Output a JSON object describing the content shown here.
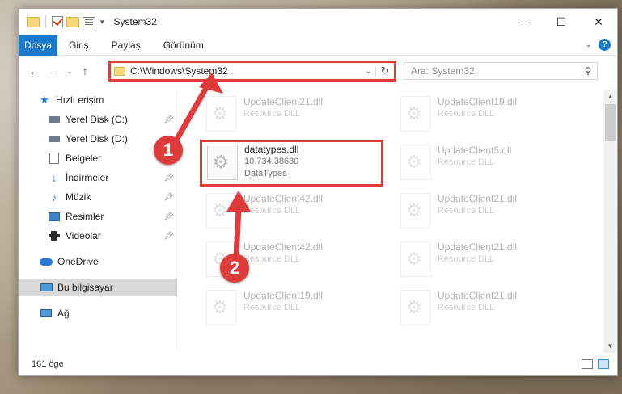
{
  "window": {
    "title": "System32",
    "controls": {
      "minimize": "—",
      "maximize": "☐",
      "close": "✕"
    }
  },
  "ribbon": {
    "tabs": [
      "Dosya",
      "Giriş",
      "Paylaş",
      "Görünüm"
    ]
  },
  "nav": {
    "back": "←",
    "forward": "→",
    "recent": "⌄",
    "up": "↑",
    "address": "C:\\Windows\\System32",
    "refresh": "↻",
    "search_placeholder": "Ara: System32"
  },
  "sidebar": {
    "items": [
      {
        "label": "Hızlı erişim",
        "icon": "star-icon"
      },
      {
        "label": "Yerel Disk (C:)",
        "icon": "drive-icon",
        "pinned": true
      },
      {
        "label": "Yerel Disk (D:)",
        "icon": "drive-icon",
        "pinned": false
      },
      {
        "label": "Belgeler",
        "icon": "documents-icon",
        "pinned": true
      },
      {
        "label": "İndirmeler",
        "icon": "download-icon",
        "pinned": true
      },
      {
        "label": "Müzik",
        "icon": "music-icon",
        "pinned": true
      },
      {
        "label": "Resimler",
        "icon": "pictures-icon",
        "pinned": true
      },
      {
        "label": "Videolar",
        "icon": "videos-icon",
        "pinned": true
      },
      {
        "label": "OneDrive",
        "icon": "cloud-icon"
      },
      {
        "label": "Bu bilgisayar",
        "icon": "computer-icon",
        "selected": true
      },
      {
        "label": "Ağ",
        "icon": "network-icon"
      }
    ]
  },
  "files": {
    "left": [
      {
        "name": "UpdateClient21.dll",
        "type": "Resource DLL"
      },
      {
        "name": "UpdateClient42.dll",
        "type": "Resource DLL"
      },
      {
        "name": "UpdateClient42.dll",
        "type": "Resource DLL"
      },
      {
        "name": "UpdateClient19.dll",
        "type": "Resource DLL"
      }
    ],
    "right": [
      {
        "name": "UpdateClient19.dll",
        "type": "Resource DLL"
      },
      {
        "name": "UpdateClient5.dll",
        "type": "Resource DLL"
      },
      {
        "name": "UpdateClient21.dll",
        "type": "Resource DLL"
      },
      {
        "name": "UpdateClient21.dll",
        "type": "Resource DLL"
      },
      {
        "name": "UpdateClient21.dll",
        "type": "Resource DLL"
      }
    ],
    "highlighted": {
      "name": "datatypes.dll",
      "version": "10.734.38680",
      "description": "DataTypes"
    }
  },
  "status": {
    "item_count": "161 öge"
  },
  "annotations": {
    "step1": "1",
    "step2": "2",
    "color": "#e03a3a"
  }
}
